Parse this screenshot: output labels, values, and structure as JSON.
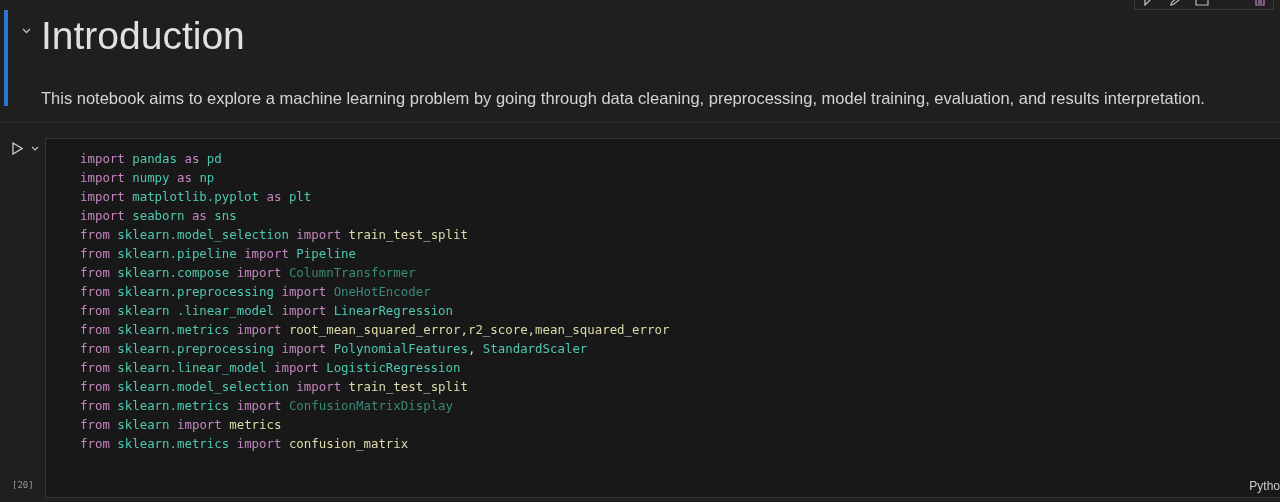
{
  "markdown_cell": {
    "heading": "Introduction",
    "paragraph": "This notebook aims to explore a machine learning problem by going through data cleaning, preprocessing, model training, evaluation, and results interpretation.",
    "selected": true,
    "expanded": true
  },
  "code_cell": {
    "execution_count": "[20]",
    "language": "Pytho",
    "lines": [
      [
        {
          "text": "import ",
          "kind": "keyword"
        },
        {
          "text": "pandas ",
          "kind": "module"
        },
        {
          "text": "as ",
          "kind": "keyword"
        },
        {
          "text": "pd",
          "kind": "module"
        }
      ],
      [
        {
          "text": "import ",
          "kind": "keyword"
        },
        {
          "text": "numpy ",
          "kind": "module"
        },
        {
          "text": "as ",
          "kind": "keyword"
        },
        {
          "text": "np",
          "kind": "module"
        }
      ],
      [
        {
          "text": "import ",
          "kind": "keyword"
        },
        {
          "text": "matplotlib.pyplot ",
          "kind": "module"
        },
        {
          "text": "as ",
          "kind": "keyword"
        },
        {
          "text": "plt",
          "kind": "module"
        }
      ],
      [
        {
          "text": "import ",
          "kind": "keyword"
        },
        {
          "text": "seaborn ",
          "kind": "module"
        },
        {
          "text": "as ",
          "kind": "keyword"
        },
        {
          "text": "sns",
          "kind": "module"
        }
      ],
      [
        {
          "text": "from ",
          "kind": "keyword"
        },
        {
          "text": "sklearn.model_selection ",
          "kind": "module"
        },
        {
          "text": "import ",
          "kind": "keyword"
        },
        {
          "text": "train_test_split",
          "kind": "function"
        }
      ],
      [
        {
          "text": "from ",
          "kind": "keyword"
        },
        {
          "text": "sklearn.pipeline ",
          "kind": "module"
        },
        {
          "text": "import ",
          "kind": "keyword"
        },
        {
          "text": "Pipeline",
          "kind": "class"
        }
      ],
      [
        {
          "text": "from ",
          "kind": "keyword"
        },
        {
          "text": "sklearn.compose ",
          "kind": "module"
        },
        {
          "text": "import ",
          "kind": "keyword"
        },
        {
          "text": "ColumnTransformer",
          "kind": "unresolved"
        }
      ],
      [
        {
          "text": "from ",
          "kind": "keyword"
        },
        {
          "text": "sklearn.preprocessing ",
          "kind": "module"
        },
        {
          "text": "import ",
          "kind": "keyword"
        },
        {
          "text": "OneHotEncoder",
          "kind": "unresolved"
        }
      ],
      [
        {
          "text": "from ",
          "kind": "keyword"
        },
        {
          "text": "sklearn .linear_model ",
          "kind": "module"
        },
        {
          "text": "import ",
          "kind": "keyword"
        },
        {
          "text": "LinearRegression",
          "kind": "class"
        }
      ],
      [
        {
          "text": "from ",
          "kind": "keyword"
        },
        {
          "text": "sklearn.metrics ",
          "kind": "module"
        },
        {
          "text": "import ",
          "kind": "keyword"
        },
        {
          "text": "root_mean_squared_error,r2_score,mean_squared_error",
          "kind": "function"
        }
      ],
      [
        {
          "text": "from ",
          "kind": "keyword"
        },
        {
          "text": "sklearn.preprocessing ",
          "kind": "module"
        },
        {
          "text": "import ",
          "kind": "keyword"
        },
        {
          "text": "PolynomialFeatures",
          "kind": "class"
        },
        {
          "text": ", ",
          "kind": "plain"
        },
        {
          "text": "StandardScaler",
          "kind": "class"
        }
      ],
      [
        {
          "text": "from ",
          "kind": "keyword"
        },
        {
          "text": "sklearn.linear_model ",
          "kind": "module"
        },
        {
          "text": "import ",
          "kind": "keyword"
        },
        {
          "text": "LogisticRegression",
          "kind": "class"
        }
      ],
      [
        {
          "text": "from ",
          "kind": "keyword"
        },
        {
          "text": "sklearn.model_selection ",
          "kind": "module"
        },
        {
          "text": "import ",
          "kind": "keyword"
        },
        {
          "text": "train_test_split",
          "kind": "function"
        }
      ],
      [
        {
          "text": "from ",
          "kind": "keyword"
        },
        {
          "text": "sklearn.metrics ",
          "kind": "module"
        },
        {
          "text": "import ",
          "kind": "keyword"
        },
        {
          "text": "ConfusionMatrixDisplay",
          "kind": "unresolved"
        }
      ],
      [
        {
          "text": "from ",
          "kind": "keyword"
        },
        {
          "text": "sklearn ",
          "kind": "module"
        },
        {
          "text": "import ",
          "kind": "keyword"
        },
        {
          "text": "metrics",
          "kind": "function"
        }
      ],
      [
        {
          "text": "from ",
          "kind": "keyword"
        },
        {
          "text": "sklearn.metrics ",
          "kind": "module"
        },
        {
          "text": "import ",
          "kind": "keyword"
        },
        {
          "text": "confusion_matrix",
          "kind": "function"
        }
      ]
    ]
  }
}
